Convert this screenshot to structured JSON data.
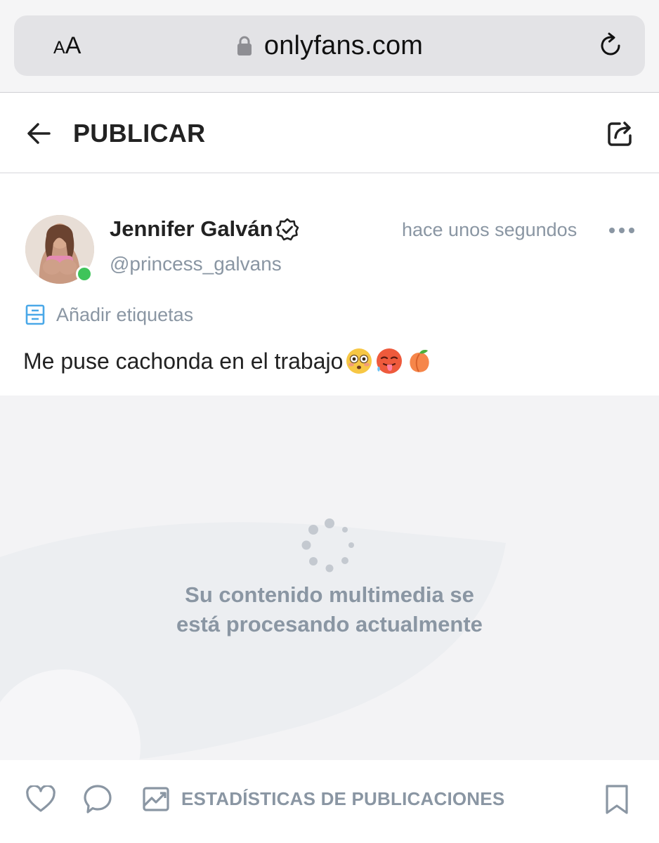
{
  "browser": {
    "text_size_label_small": "A",
    "text_size_label_large": "A",
    "url": "onlyfans.com",
    "icons": {
      "lock": "lock-icon",
      "reload": "reload-icon"
    }
  },
  "header": {
    "title": "PUBLICAR",
    "icons": {
      "back": "arrow-left-icon",
      "share": "share-icon"
    }
  },
  "post": {
    "author": {
      "name": "Jennifer Galván",
      "handle": "@princess_galvans",
      "verified": true,
      "online": true,
      "online_color": "#3fc45a"
    },
    "time": "hace unos segundos",
    "tags_label": "Añadir etiquetas",
    "text": "Me puse cachonda en el trabajo",
    "emojis": [
      "flushed-face",
      "hot-face",
      "peach"
    ],
    "media": {
      "status_line1": "Su contenido multimedia se",
      "status_line2": "está procesando actualmente"
    }
  },
  "footer": {
    "stats_label": "ESTADÍSTICAS DE PUBLICACIONES",
    "icons": [
      "heart-icon",
      "comment-icon",
      "stats-chart-icon",
      "bookmark-icon"
    ]
  },
  "colors": {
    "muted_text": "#8a96a3",
    "accent_blue": "#00aff0",
    "media_bg": "#f3f3f5"
  }
}
